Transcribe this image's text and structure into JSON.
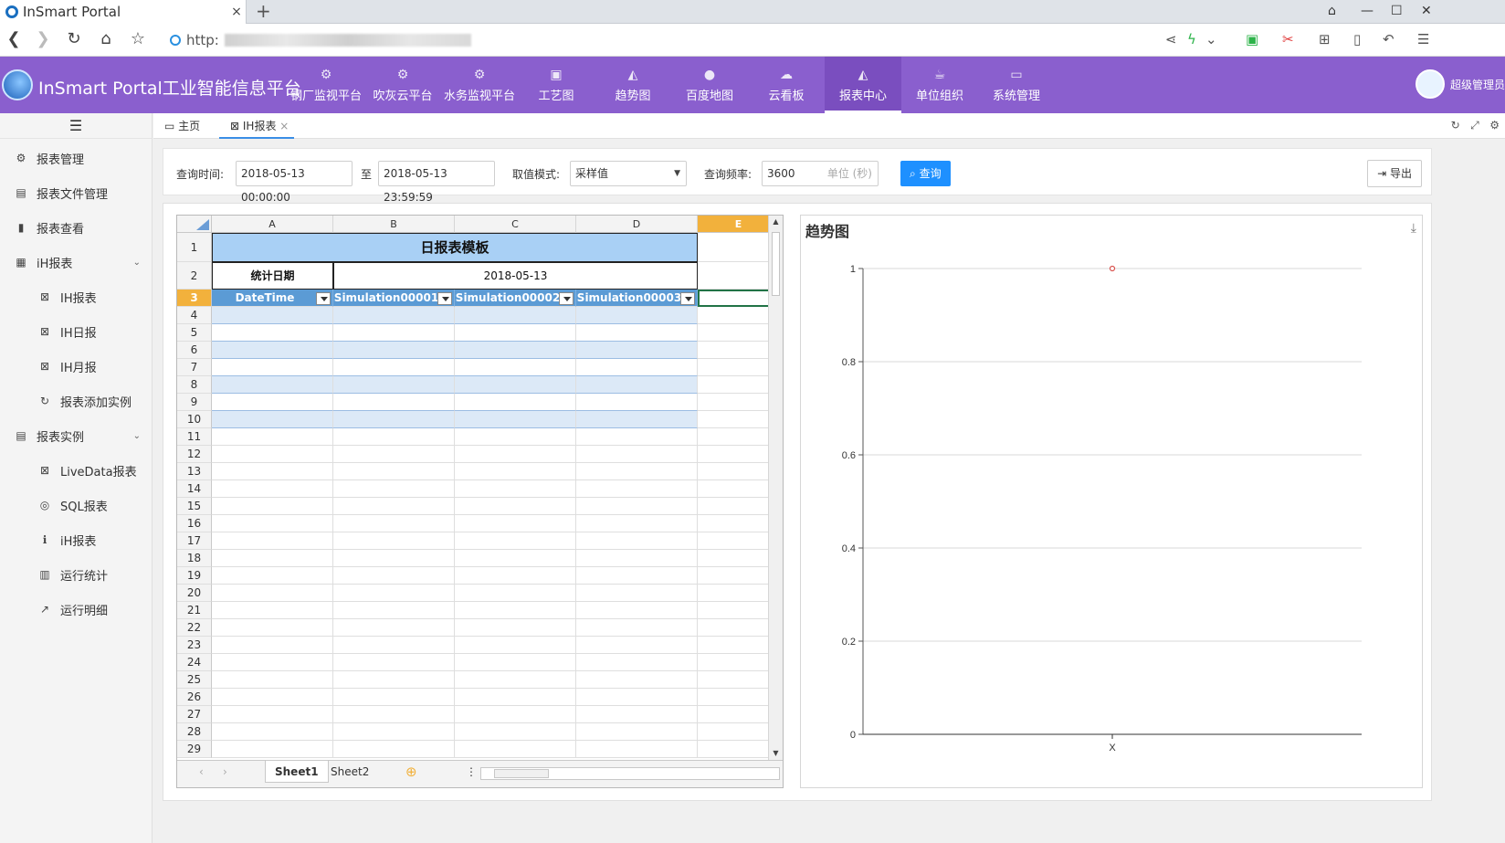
{
  "browser": {
    "tab_title": "InSmart Portal",
    "tab_close": "×",
    "new_tab": "+",
    "url_prefix": "http:",
    "win_controls": [
      "⌂",
      "—",
      "☐",
      "✕"
    ]
  },
  "header": {
    "title": "InSmart Portal工业智能信息平台",
    "nav": [
      {
        "label": "钢厂监视平台",
        "icon": "gears-icon",
        "glyph": "⚙"
      },
      {
        "label": "吹灰云平台",
        "icon": "gears-icon",
        "glyph": "⚙"
      },
      {
        "label": "水务监视平台",
        "icon": "gears-icon",
        "glyph": "⚙"
      },
      {
        "label": "工艺图",
        "icon": "image-icon",
        "glyph": "▣"
      },
      {
        "label": "趋势图",
        "icon": "area-chart-icon",
        "glyph": "◭"
      },
      {
        "label": "百度地图",
        "icon": "map-marker-icon",
        "glyph": "●"
      },
      {
        "label": "云看板",
        "icon": "cloud-icon",
        "glyph": "☁"
      },
      {
        "label": "报表中心",
        "icon": "area-chart-icon",
        "glyph": "◭",
        "active": true
      },
      {
        "label": "单位组织",
        "icon": "cup-icon",
        "glyph": "☕"
      },
      {
        "label": "系统管理",
        "icon": "desktop-icon",
        "glyph": "▭"
      }
    ],
    "user_name": "超级管理员"
  },
  "sidebar": {
    "toggle": "☰",
    "items": [
      {
        "label": "报表管理",
        "icon": "gears-icon",
        "glyph": "⚙",
        "level": 1
      },
      {
        "label": "报表文件管理",
        "icon": "id-card-icon",
        "glyph": "▤",
        "level": 1
      },
      {
        "label": "报表查看",
        "icon": "file-icon",
        "glyph": "▮",
        "level": 1
      },
      {
        "label": "iH报表",
        "icon": "calendar-icon",
        "glyph": "▦",
        "level": 1,
        "expand": "⌄"
      },
      {
        "label": "IH报表",
        "icon": "excel-file-icon",
        "glyph": "⊠",
        "level": 2
      },
      {
        "label": "IH日报",
        "icon": "excel-file-icon",
        "glyph": "⊠",
        "level": 2
      },
      {
        "label": "IH月报",
        "icon": "excel-file-icon",
        "glyph": "⊠",
        "level": 2
      },
      {
        "label": "报表添加实例",
        "icon": "refresh-icon",
        "glyph": "↻",
        "level": 2
      },
      {
        "label": "报表实例",
        "icon": "file-text-icon",
        "glyph": "▤",
        "level": 1,
        "expand": "⌄"
      },
      {
        "label": "LiveData报表",
        "icon": "excel-file-icon",
        "glyph": "⊠",
        "level": 2
      },
      {
        "label": "SQL报表",
        "icon": "chrome-icon",
        "glyph": "◎",
        "level": 2
      },
      {
        "label": "iH报表",
        "icon": "info-icon",
        "glyph": "ℹ",
        "level": 2
      },
      {
        "label": "运行统计",
        "icon": "bar-chart-icon",
        "glyph": "▥",
        "level": 2
      },
      {
        "label": "运行明细",
        "icon": "line-chart-icon",
        "glyph": "↗",
        "level": 2
      }
    ]
  },
  "content_tabs": [
    {
      "label": "主页",
      "icon": "desktop-icon",
      "glyph": "▭"
    },
    {
      "label": "IH报表",
      "icon": "excel-file-icon",
      "glyph": "⊠",
      "close": "×",
      "active": true
    }
  ],
  "tab_tools": [
    "↻",
    "⤢",
    "⚙"
  ],
  "query": {
    "time_label": "查询时间:",
    "start": "2018-05-13 00:00:00",
    "to": "至",
    "end": "2018-05-13 23:59:59",
    "mode_label": "取值模式:",
    "mode_value": "采样值",
    "freq_label": "查询频率:",
    "freq_value": "3600",
    "freq_unit": "单位 (秒)",
    "search_button": "查询",
    "export_button": "导出"
  },
  "spreadsheet": {
    "columns": [
      "A",
      "B",
      "C",
      "D",
      "E"
    ],
    "selected_column": "E",
    "selected_row": 3,
    "title": "日报表模板",
    "stat_date_label": "统计日期",
    "stat_date_value": "2018-05-13",
    "header_row": [
      "DateTime",
      "Simulation00001",
      "Simulation00002",
      "Simulation00003"
    ],
    "row_count": 29,
    "sheets": [
      "Sheet1",
      "Sheet2"
    ],
    "active_sheet": "Sheet1"
  },
  "chart": {
    "title": "趋势图"
  },
  "chart_data": {
    "type": "scatter",
    "title": "趋势图",
    "x": [
      "X"
    ],
    "series": [
      {
        "values": [
          1
        ]
      }
    ],
    "ylim": [
      0,
      1
    ],
    "yticks": [
      "0",
      "0.2",
      "0.4",
      "0.6",
      "0.8",
      "1"
    ],
    "grid": true,
    "point_color": "#d9534f"
  },
  "colors": {
    "header_purple": "#8a5fce",
    "primary_blue": "#1e90ff",
    "selected_orange": "#f2b13c",
    "table_header_blue": "#5b9bd5",
    "title_fill": "#a9d0f5"
  }
}
